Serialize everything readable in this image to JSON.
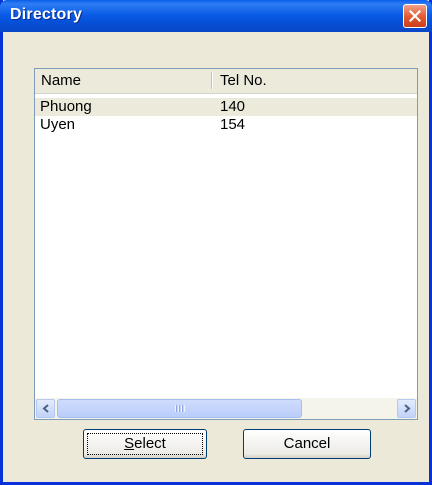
{
  "window": {
    "title": "Directory"
  },
  "columns": {
    "name": "Name",
    "tel": "Tel No."
  },
  "rows": [
    {
      "name": "Phuong",
      "tel": "140"
    },
    {
      "name": "Uyen",
      "tel": "154"
    }
  ],
  "buttons": {
    "select_mnemonic": "S",
    "select_rest": "elect",
    "cancel": "Cancel"
  },
  "colors": {
    "titlebar": "#0a5ce6",
    "close": "#e2582f",
    "dialog_bg": "#ece9d8"
  }
}
